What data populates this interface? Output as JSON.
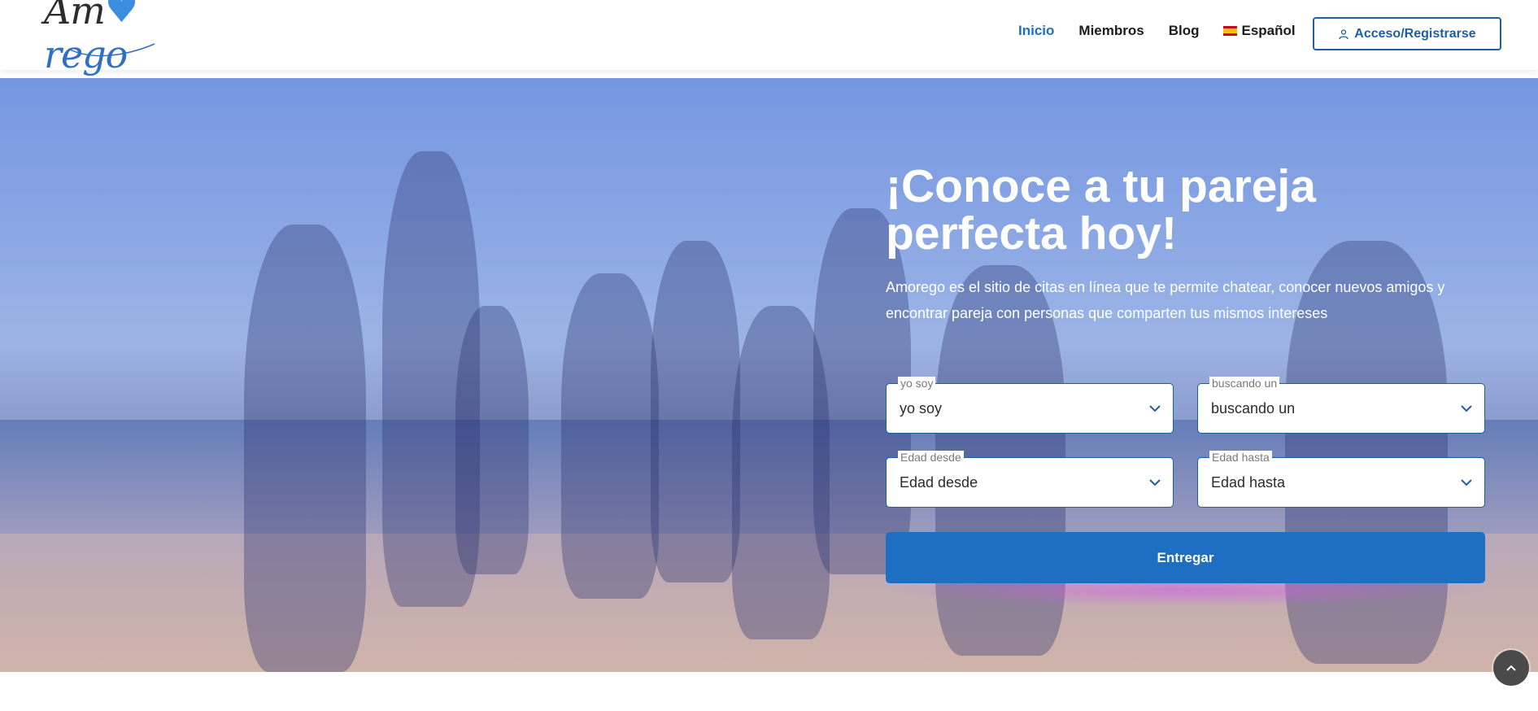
{
  "header": {
    "logo_text_start": "Am",
    "logo_text_end": "rego",
    "nav": [
      {
        "label": "Inicio",
        "active": true
      },
      {
        "label": "Miembros",
        "active": false
      },
      {
        "label": "Blog",
        "active": false
      },
      {
        "label": "Español",
        "active": false,
        "icon": "spain-flag-icon"
      }
    ],
    "login_label": "Acceso/Registrarse"
  },
  "hero": {
    "title": "¡Conoce a tu pareja perfecta hoy!",
    "subtitle": "Amorego es el sitio de citas en línea que te permite chatear, conocer nuevos amigos y encontrar pareja con personas que comparten tus mismos intereses",
    "form": {
      "fields": [
        {
          "label": "yo soy",
          "value": "yo soy"
        },
        {
          "label": "buscando un",
          "value": "buscando un"
        },
        {
          "label": "Edad desde",
          "value": "Edad desde"
        },
        {
          "label": "Edad hasta",
          "value": "Edad hasta"
        }
      ],
      "submit_label": "Entregar"
    }
  },
  "colors": {
    "accent": "#1f6fbf",
    "button": "#1e6fc2",
    "border": "#1f5fa0"
  }
}
